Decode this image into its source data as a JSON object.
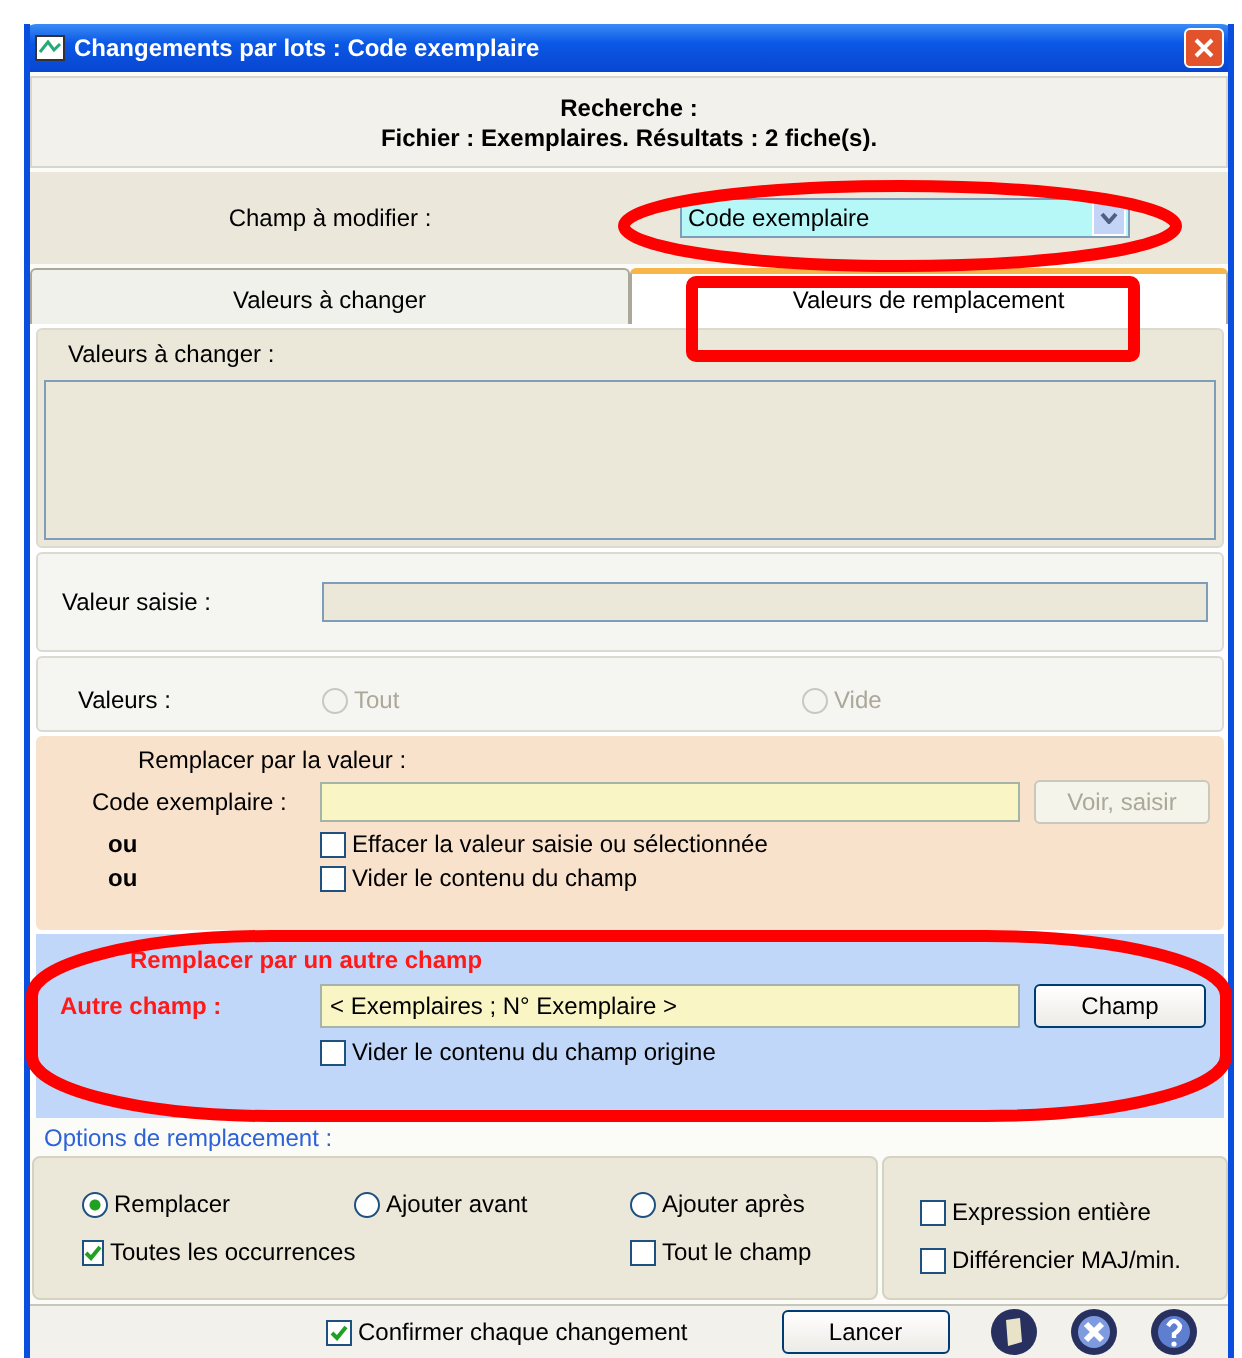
{
  "window": {
    "title": "Changements par lots : Code exemplaire"
  },
  "search_summary": {
    "heading": "Recherche :",
    "details": "Fichier : Exemplaires. Résultats : 2 fiche(s)."
  },
  "field_to_modify": {
    "label": "Champ à modifier :",
    "value": "Code exemplaire"
  },
  "tabs": [
    {
      "label": "Valeurs à changer",
      "selected": false
    },
    {
      "label": "Valeurs de remplacement",
      "selected": true
    }
  ],
  "values_to_change": {
    "title": "Valeurs à changer :"
  },
  "entered_value": {
    "label": "Valeur saisie :"
  },
  "values": {
    "label": "Valeurs :",
    "options": [
      {
        "label": "Tout",
        "selected": false,
        "disabled": true
      },
      {
        "label": "Vide",
        "selected": false,
        "disabled": true
      }
    ]
  },
  "replace_value": {
    "title": "Remplacer par la valeur :",
    "field_label": "Code exemplaire :",
    "button": "Voir, saisir",
    "button_disabled": true,
    "options": [
      {
        "prefix": "ou",
        "label": "Effacer la valeur saisie ou sélectionnée",
        "checked": false
      },
      {
        "prefix": "ou",
        "label": "Vider le contenu du champ",
        "checked": false
      }
    ]
  },
  "replace_field": {
    "title": "Remplacer par un autre champ",
    "field_label": "Autre champ :",
    "value": "< Exemplaires ; N° Exemplaire >",
    "button": "Champ",
    "option": {
      "label": "Vider le contenu du champ origine",
      "checked": false
    }
  },
  "replace_options": {
    "title": "Options de remplacement :",
    "modes": [
      {
        "label": "Remplacer",
        "selected": true
      },
      {
        "label": "Ajouter avant",
        "selected": false
      },
      {
        "label": "Ajouter après",
        "selected": false
      }
    ],
    "checks": [
      {
        "label": "Toutes les occurrences",
        "checked": true
      },
      {
        "label": "Tout le champ",
        "checked": false
      }
    ],
    "match_checks": [
      {
        "label": "Expression entière",
        "checked": false
      },
      {
        "label": "Différencier MAJ/min.",
        "checked": false
      }
    ]
  },
  "footer": {
    "confirm": {
      "label": "Confirmer chaque changement",
      "checked": true
    },
    "launch_button": "Lancer"
  }
}
